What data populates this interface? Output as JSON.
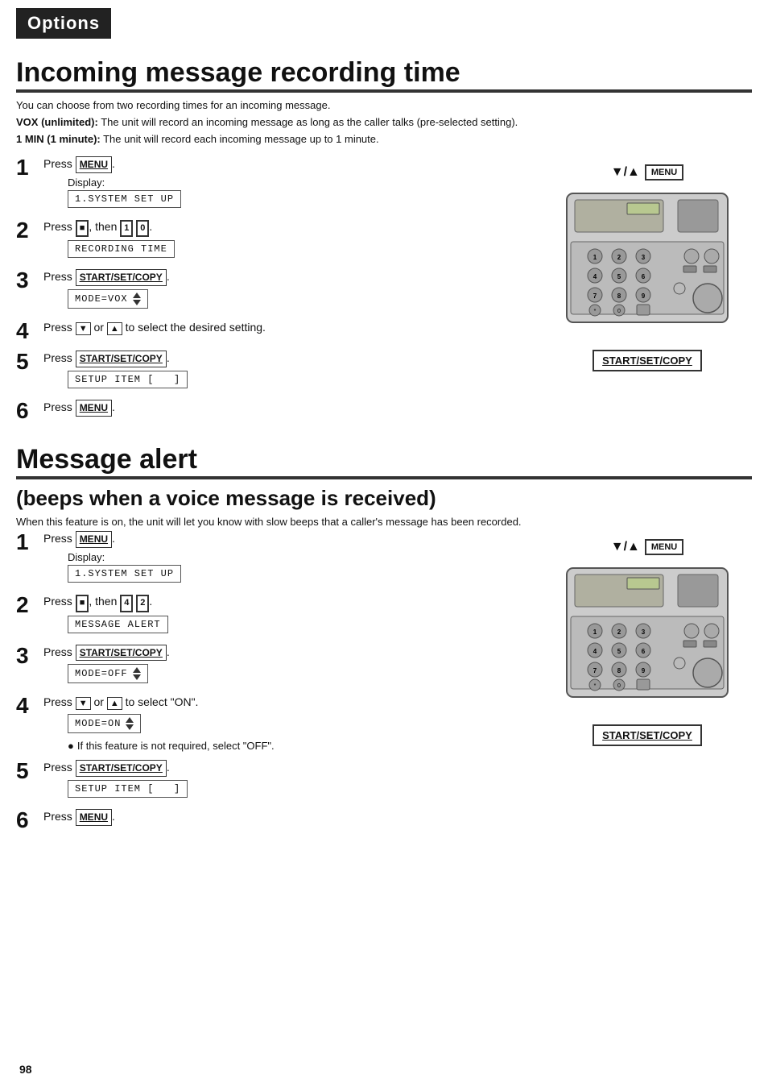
{
  "header": {
    "label": "Options"
  },
  "section1": {
    "title": "Incoming message recording time",
    "intro": "You can choose from two recording times for an incoming message.",
    "bold_intro": "VOX (unlimited):  The unit will record an incoming message as long as the caller talks (pre-selected setting).\n1 MIN (1 minute):  The unit will record each incoming message up to 1 minute.",
    "steps": [
      {
        "num": "1",
        "text": "Press MENU.",
        "display": "1.SYSTEM SET UP"
      },
      {
        "num": "2",
        "text": "Press ■, then 1 0.",
        "display": "RECORDING TIME"
      },
      {
        "num": "3",
        "text": "Press START/SET/COPY.",
        "display": "MODE=VOX"
      },
      {
        "num": "4",
        "text": "Press ▼ or ▲ to select the desired setting.",
        "display": null
      },
      {
        "num": "5",
        "text": "Press START/SET/COPY.",
        "display": "SETUP ITEM [   ]"
      },
      {
        "num": "6",
        "text": "Press MENU.",
        "display": null
      }
    ]
  },
  "section2": {
    "title": "Message alert",
    "subtitle": "(beeps when a voice message is received)",
    "intro": "When this feature is on, the unit will let you know with slow beeps that a caller's message has been recorded.",
    "steps": [
      {
        "num": "1",
        "text": "Press MENU.",
        "display": "1.SYSTEM SET UP"
      },
      {
        "num": "2",
        "text": "Press ■, then 4 2.",
        "display": "MESSAGE ALERT"
      },
      {
        "num": "3",
        "text": "Press START/SET/COPY.",
        "display": "MODE=OFF"
      },
      {
        "num": "4",
        "text": "Press ▼ or ▲ to select \"ON\".",
        "display": "MODE=ON",
        "note": "● If this feature is not required, select \"OFF\"."
      },
      {
        "num": "5",
        "text": "Press START/SET/COPY.",
        "display": "SETUP ITEM [   ]"
      },
      {
        "num": "6",
        "text": "Press MENU.",
        "display": null
      }
    ]
  },
  "page_number": "98",
  "diagram1": {
    "arrows": "▼/▲",
    "menu": "MENU",
    "start_set_copy": "START/SET/COPY"
  },
  "diagram2": {
    "arrows": "▼/▲",
    "menu": "MENU",
    "start_set_copy": "START/SET/COPY"
  }
}
